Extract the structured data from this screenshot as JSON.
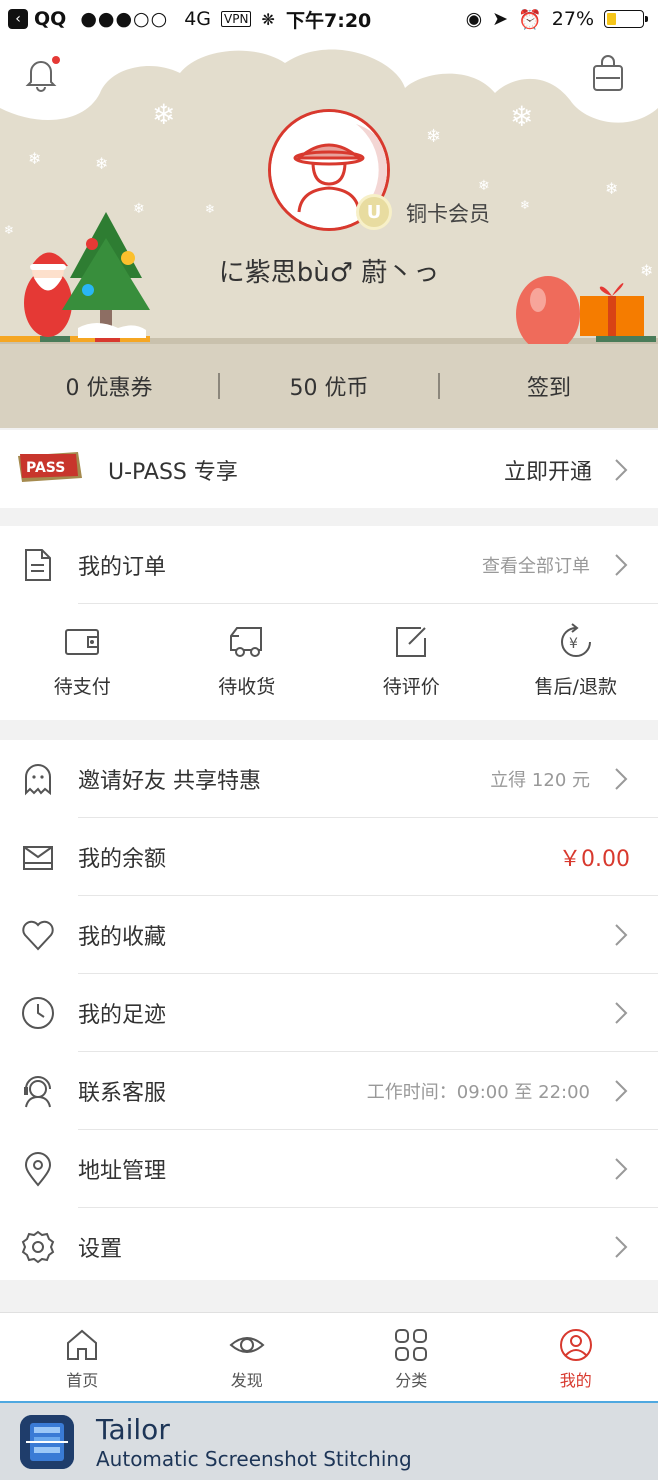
{
  "status_bar": {
    "app": "QQ",
    "signal": "●●●○○",
    "network": "4G",
    "vpn": "VPN",
    "time": "下午7:20",
    "battery": "27%",
    "battery_level": 0.27
  },
  "profile": {
    "member_level": "铜卡会员",
    "badge_letter": "U",
    "username": "に紫思bù♂ 蔚丶っ"
  },
  "stats": {
    "coupons": "0 优惠券",
    "coins": "50 优币",
    "checkin": "签到"
  },
  "upass": {
    "logo_text": "PASS",
    "title": "U-PASS 专享",
    "action": "立即开通"
  },
  "orders": {
    "title": "我的订单",
    "view_all": "查看全部订单",
    "items": [
      {
        "label": "待支付",
        "icon": "wallet-icon"
      },
      {
        "label": "待收货",
        "icon": "truck-icon"
      },
      {
        "label": "待评价",
        "icon": "edit-icon"
      },
      {
        "label": "售后/退款",
        "icon": "refund-icon"
      }
    ]
  },
  "menu": [
    {
      "label": "邀请好友 共享特惠",
      "right": "立得 120 元",
      "icon": "ghost-icon"
    },
    {
      "label": "我的余额",
      "right": "￥0.00",
      "icon": "balance-icon",
      "right_color": "#d8392e"
    },
    {
      "label": "我的收藏",
      "right": "",
      "icon": "heart-icon"
    },
    {
      "label": "我的足迹",
      "right": "",
      "icon": "clock-icon"
    },
    {
      "label": "联系客服",
      "right": "工作时间：09:00 至 22:00",
      "icon": "headset-icon"
    },
    {
      "label": "地址管理",
      "right": "",
      "icon": "location-icon"
    },
    {
      "label": "设置",
      "right": "",
      "icon": "gear-icon"
    }
  ],
  "tabs": [
    {
      "label": "首页",
      "icon": "home-icon",
      "active": false
    },
    {
      "label": "发现",
      "icon": "eye-icon",
      "active": false
    },
    {
      "label": "分类",
      "icon": "grid-icon",
      "active": false
    },
    {
      "label": "我的",
      "icon": "user-icon",
      "active": true
    }
  ],
  "watermark": {
    "title": "Tailor",
    "subtitle": "Automatic Screenshot Stitching"
  },
  "colors": {
    "accent": "#d8392e",
    "scene_bg": "#e3ddcd",
    "stats_bg": "#d8d1c0"
  }
}
